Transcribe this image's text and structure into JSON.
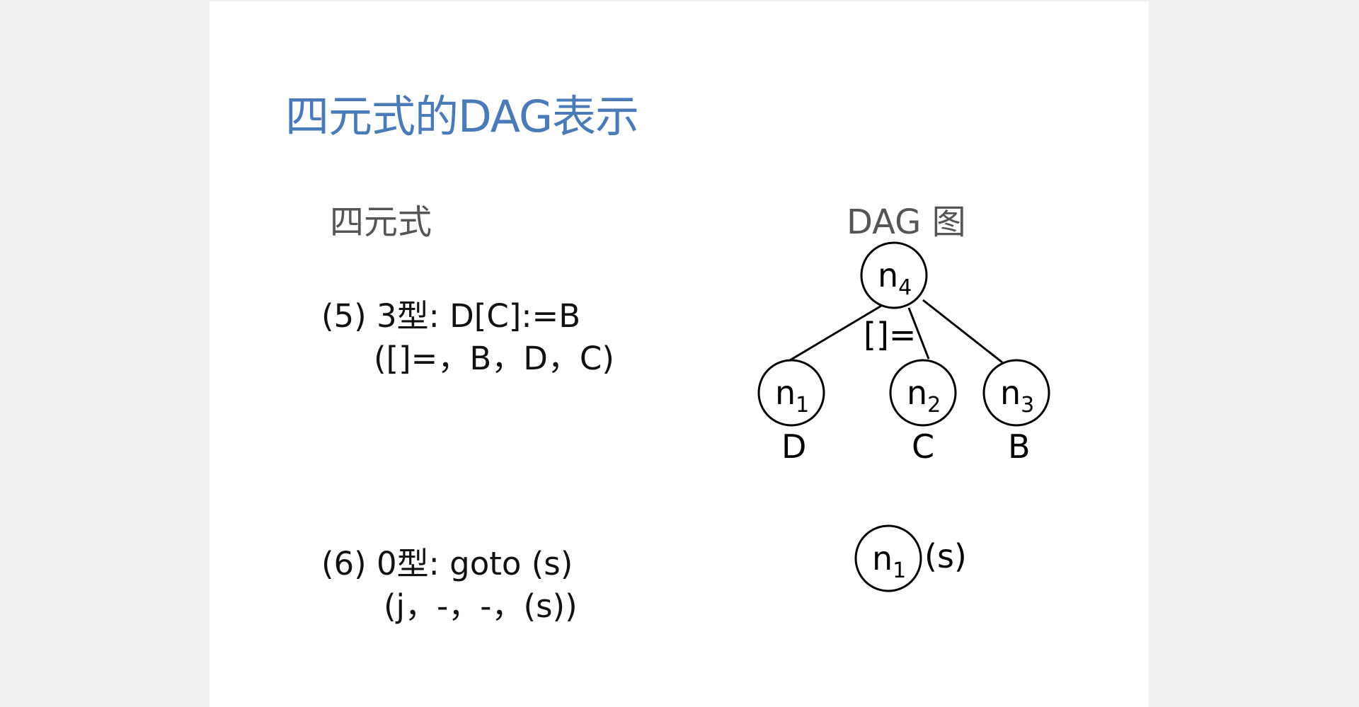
{
  "slide": {
    "title": "四元式的DAG表示",
    "left_heading": "四元式",
    "right_heading": "DAG 图"
  },
  "quads": {
    "q5": {
      "line1": "(5)  3型: D[C]:=B",
      "line2": "([]=，B，D，C)"
    },
    "q6": {
      "line1": "(6)  0型: goto (s)",
      "line2": "(j，-，-，(s))"
    }
  },
  "dag1": {
    "root": {
      "base": "n",
      "sub": "4"
    },
    "operator": "[]=",
    "children": [
      {
        "base": "n",
        "sub": "1",
        "label": "D"
      },
      {
        "base": "n",
        "sub": "2",
        "label": "C"
      },
      {
        "base": "n",
        "sub": "3",
        "label": "B"
      }
    ]
  },
  "dag2": {
    "node": {
      "base": "n",
      "sub": "1"
    },
    "label": "(s)"
  }
}
